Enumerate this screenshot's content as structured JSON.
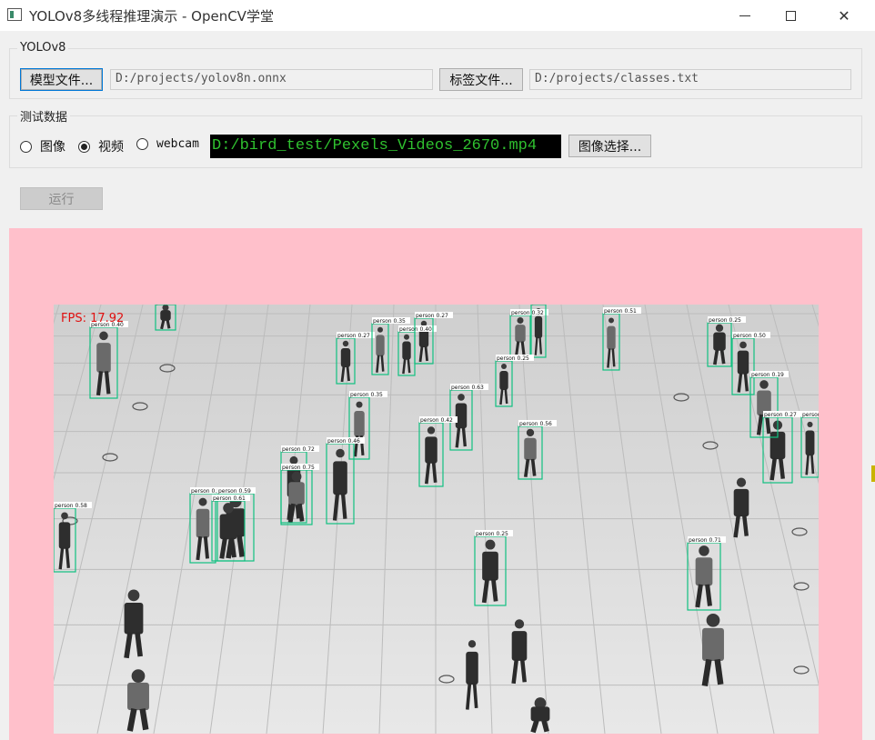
{
  "window": {
    "title": "YOLOv8多线程推理演示 - OpenCV学堂",
    "controls": {
      "minimize": "minimize",
      "maximize": "maximize",
      "close": "✕"
    }
  },
  "model_group": {
    "title": "YOLOv8",
    "model_button": "模型文件...",
    "model_path": "D:/projects/yolov8n.onnx",
    "label_button": "标签文件...",
    "label_path": "D:/projects/classes.txt"
  },
  "data_group": {
    "title": "测试数据",
    "options": [
      {
        "label": "图像",
        "checked": false
      },
      {
        "label": "视频",
        "checked": true
      },
      {
        "label": "webcam",
        "checked": false
      }
    ],
    "selected_path": "D:/bird_test/Pexels_Videos_2670.mp4",
    "select_button": "图像选择..."
  },
  "run_button": {
    "label": "运行",
    "enabled": false
  },
  "display": {
    "background": "#ffc0cb",
    "fps_text": "FPS: 17.92",
    "box_color": "#10c080",
    "detection_label": "person",
    "detections": [
      {
        "label": "person 0.40"
      },
      {
        "label": "person 0.25"
      },
      {
        "label": "person 0.27"
      },
      {
        "label": "person 0.35"
      },
      {
        "label": "person 0.40"
      },
      {
        "label": "person 0.27"
      },
      {
        "label": "person 0.32"
      },
      {
        "label": "person 0.53"
      },
      {
        "label": "person 0.25"
      },
      {
        "label": "person 0.51"
      },
      {
        "label": "person 0.25"
      },
      {
        "label": "person 0.50"
      },
      {
        "label": "person 0.19"
      },
      {
        "label": "person 0.27"
      },
      {
        "label": "person 0.45"
      },
      {
        "label": "person 0.35"
      },
      {
        "label": "person 0.63"
      },
      {
        "label": "person 0.42"
      },
      {
        "label": "person 0.56"
      },
      {
        "label": "person 0.72"
      },
      {
        "label": "person 0.46"
      },
      {
        "label": "person 0.52"
      },
      {
        "label": "person 0.59"
      },
      {
        "label": "person 0.61"
      },
      {
        "label": "person 0.75"
      },
      {
        "label": "person 0.58"
      },
      {
        "label": "person 0.25"
      },
      {
        "label": "person 0.71"
      }
    ]
  }
}
